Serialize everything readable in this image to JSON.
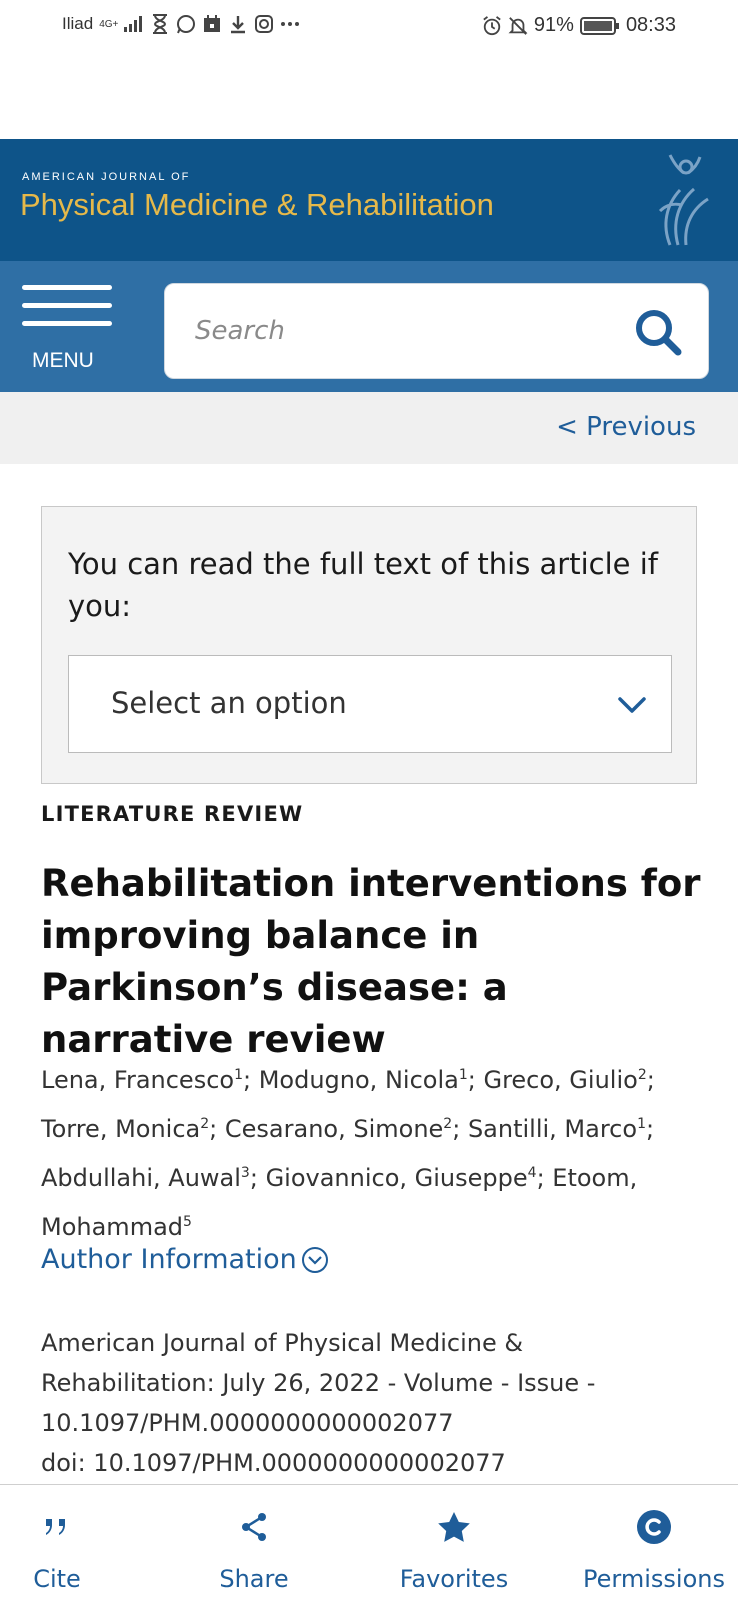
{
  "status_bar": {
    "carrier": "Iliad",
    "network": "4G+",
    "battery": "91%",
    "time": "08:33"
  },
  "journal": {
    "small_title": "AMERICAN JOURNAL OF",
    "title": "Physical Medicine & Rehabilitation"
  },
  "nav": {
    "menu_label": "MENU",
    "search_placeholder": "Search"
  },
  "previous_label": "< Previous",
  "access_box": {
    "text": "You can read the full text of this article if you:",
    "select_value": "Select an option"
  },
  "article": {
    "type": "LITERATURE REVIEW",
    "title": "Rehabilitation interventions for improving balance in Parkinson’s disease: a narrative review",
    "authors": [
      {
        "name": "Lena, Francesco",
        "aff": "1"
      },
      {
        "name": "Modugno, Nicola",
        "aff": "1"
      },
      {
        "name": "Greco, Giulio",
        "aff": "2"
      },
      {
        "name": "Torre, Monica",
        "aff": "2"
      },
      {
        "name": "Cesarano, Simone",
        "aff": "2"
      },
      {
        "name": "Santilli, Marco",
        "aff": "1"
      },
      {
        "name": "Abdullahi, Auwal",
        "aff": "3"
      },
      {
        "name": "Giovannico, Giuseppe",
        "aff": "4"
      },
      {
        "name": "Etoom, Mohammad",
        "aff": "5"
      }
    ],
    "author_info_label": "Author Information",
    "citation_line1": "American Journal of Physical Medicine &",
    "citation_line2": "Rehabilitation: July 26, 2022 - Volume - Issue -",
    "citation_line3": "10.1097/PHM.0000000000002077",
    "doi_line": "doi: 10.1097/PHM.0000000000002077"
  },
  "toolbar": {
    "cite": "Cite",
    "share": "Share",
    "favorites": "Favorites",
    "permissions": "Permissions"
  },
  "colors": {
    "header_blue": "#0e5489",
    "nav_blue": "#2f6fa5",
    "title_gold": "#e6b94a",
    "link_blue": "#1f5d99"
  }
}
